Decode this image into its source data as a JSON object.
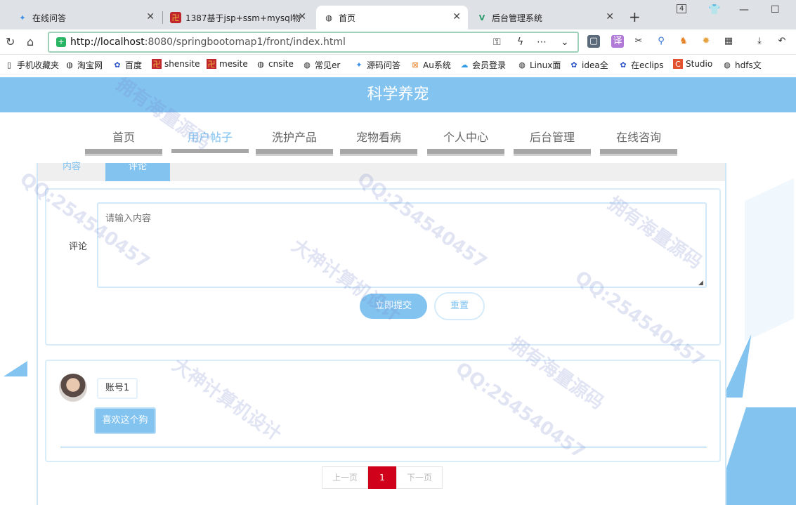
{
  "browser": {
    "tabs": [
      {
        "title": "在线问答",
        "icon": "question-icon"
      },
      {
        "title": "1387基于jsp+ssm+mysql物",
        "icon": "site-favicon"
      },
      {
        "title": "首页",
        "icon": "globe-icon"
      },
      {
        "title": "后台管理系统",
        "icon": "vue-icon"
      }
    ],
    "new_tab": "+",
    "tab_count_badge": "4",
    "url_host": "http://localhost",
    "url_path": ":8080/springbootomap1/front/index.html",
    "bookmarks": [
      "手机收藏夹",
      "淘宝网",
      "百度",
      "shensite",
      "mesite",
      "cnsite",
      "常见er",
      "源码问答",
      "Au系统",
      "会员登录",
      "Linux面",
      "idea全",
      "在eclips",
      "Studio",
      "hdfs文"
    ]
  },
  "site": {
    "title": "科学养宠",
    "nav": [
      "首页",
      "用户帖子",
      "洗护产品",
      "宠物看病",
      "个人中心",
      "后台管理",
      "在线咨询"
    ],
    "active_nav_index": 1
  },
  "detail": {
    "subtabs": [
      "内容",
      "评论"
    ],
    "active_subtab_index": 1,
    "comment_label": "评论",
    "comment_placeholder": "请输入内容",
    "submit_label": "立即提交",
    "reset_label": "重置"
  },
  "comments": [
    {
      "user": "账号1",
      "text": "喜欢这个狗"
    }
  ],
  "pagination": {
    "prev": "上一页",
    "current": "1",
    "next": "下一页"
  },
  "watermarks": [
    "QQ:254540457",
    "拥有海量源码",
    "大神计算机设计"
  ],
  "colors": {
    "primary": "#82c3f0",
    "pager_active": "#d0021b"
  }
}
